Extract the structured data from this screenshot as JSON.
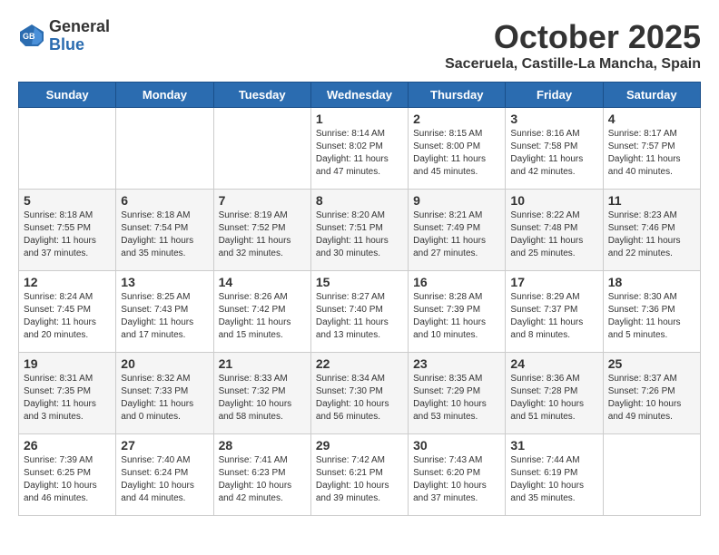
{
  "logo": {
    "general": "General",
    "blue": "Blue"
  },
  "title": "October 2025",
  "location": "Saceruela, Castille-La Mancha, Spain",
  "headers": [
    "Sunday",
    "Monday",
    "Tuesday",
    "Wednesday",
    "Thursday",
    "Friday",
    "Saturday"
  ],
  "weeks": [
    [
      {
        "day": "",
        "info": ""
      },
      {
        "day": "",
        "info": ""
      },
      {
        "day": "",
        "info": ""
      },
      {
        "day": "1",
        "info": "Sunrise: 8:14 AM\nSunset: 8:02 PM\nDaylight: 11 hours\nand 47 minutes."
      },
      {
        "day": "2",
        "info": "Sunrise: 8:15 AM\nSunset: 8:00 PM\nDaylight: 11 hours\nand 45 minutes."
      },
      {
        "day": "3",
        "info": "Sunrise: 8:16 AM\nSunset: 7:58 PM\nDaylight: 11 hours\nand 42 minutes."
      },
      {
        "day": "4",
        "info": "Sunrise: 8:17 AM\nSunset: 7:57 PM\nDaylight: 11 hours\nand 40 minutes."
      }
    ],
    [
      {
        "day": "5",
        "info": "Sunrise: 8:18 AM\nSunset: 7:55 PM\nDaylight: 11 hours\nand 37 minutes."
      },
      {
        "day": "6",
        "info": "Sunrise: 8:18 AM\nSunset: 7:54 PM\nDaylight: 11 hours\nand 35 minutes."
      },
      {
        "day": "7",
        "info": "Sunrise: 8:19 AM\nSunset: 7:52 PM\nDaylight: 11 hours\nand 32 minutes."
      },
      {
        "day": "8",
        "info": "Sunrise: 8:20 AM\nSunset: 7:51 PM\nDaylight: 11 hours\nand 30 minutes."
      },
      {
        "day": "9",
        "info": "Sunrise: 8:21 AM\nSunset: 7:49 PM\nDaylight: 11 hours\nand 27 minutes."
      },
      {
        "day": "10",
        "info": "Sunrise: 8:22 AM\nSunset: 7:48 PM\nDaylight: 11 hours\nand 25 minutes."
      },
      {
        "day": "11",
        "info": "Sunrise: 8:23 AM\nSunset: 7:46 PM\nDaylight: 11 hours\nand 22 minutes."
      }
    ],
    [
      {
        "day": "12",
        "info": "Sunrise: 8:24 AM\nSunset: 7:45 PM\nDaylight: 11 hours\nand 20 minutes."
      },
      {
        "day": "13",
        "info": "Sunrise: 8:25 AM\nSunset: 7:43 PM\nDaylight: 11 hours\nand 17 minutes."
      },
      {
        "day": "14",
        "info": "Sunrise: 8:26 AM\nSunset: 7:42 PM\nDaylight: 11 hours\nand 15 minutes."
      },
      {
        "day": "15",
        "info": "Sunrise: 8:27 AM\nSunset: 7:40 PM\nDaylight: 11 hours\nand 13 minutes."
      },
      {
        "day": "16",
        "info": "Sunrise: 8:28 AM\nSunset: 7:39 PM\nDaylight: 11 hours\nand 10 minutes."
      },
      {
        "day": "17",
        "info": "Sunrise: 8:29 AM\nSunset: 7:37 PM\nDaylight: 11 hours\nand 8 minutes."
      },
      {
        "day": "18",
        "info": "Sunrise: 8:30 AM\nSunset: 7:36 PM\nDaylight: 11 hours\nand 5 minutes."
      }
    ],
    [
      {
        "day": "19",
        "info": "Sunrise: 8:31 AM\nSunset: 7:35 PM\nDaylight: 11 hours\nand 3 minutes."
      },
      {
        "day": "20",
        "info": "Sunrise: 8:32 AM\nSunset: 7:33 PM\nDaylight: 11 hours\nand 0 minutes."
      },
      {
        "day": "21",
        "info": "Sunrise: 8:33 AM\nSunset: 7:32 PM\nDaylight: 10 hours\nand 58 minutes."
      },
      {
        "day": "22",
        "info": "Sunrise: 8:34 AM\nSunset: 7:30 PM\nDaylight: 10 hours\nand 56 minutes."
      },
      {
        "day": "23",
        "info": "Sunrise: 8:35 AM\nSunset: 7:29 PM\nDaylight: 10 hours\nand 53 minutes."
      },
      {
        "day": "24",
        "info": "Sunrise: 8:36 AM\nSunset: 7:28 PM\nDaylight: 10 hours\nand 51 minutes."
      },
      {
        "day": "25",
        "info": "Sunrise: 8:37 AM\nSunset: 7:26 PM\nDaylight: 10 hours\nand 49 minutes."
      }
    ],
    [
      {
        "day": "26",
        "info": "Sunrise: 7:39 AM\nSunset: 6:25 PM\nDaylight: 10 hours\nand 46 minutes."
      },
      {
        "day": "27",
        "info": "Sunrise: 7:40 AM\nSunset: 6:24 PM\nDaylight: 10 hours\nand 44 minutes."
      },
      {
        "day": "28",
        "info": "Sunrise: 7:41 AM\nSunset: 6:23 PM\nDaylight: 10 hours\nand 42 minutes."
      },
      {
        "day": "29",
        "info": "Sunrise: 7:42 AM\nSunset: 6:21 PM\nDaylight: 10 hours\nand 39 minutes."
      },
      {
        "day": "30",
        "info": "Sunrise: 7:43 AM\nSunset: 6:20 PM\nDaylight: 10 hours\nand 37 minutes."
      },
      {
        "day": "31",
        "info": "Sunrise: 7:44 AM\nSunset: 6:19 PM\nDaylight: 10 hours\nand 35 minutes."
      },
      {
        "day": "",
        "info": ""
      }
    ]
  ]
}
